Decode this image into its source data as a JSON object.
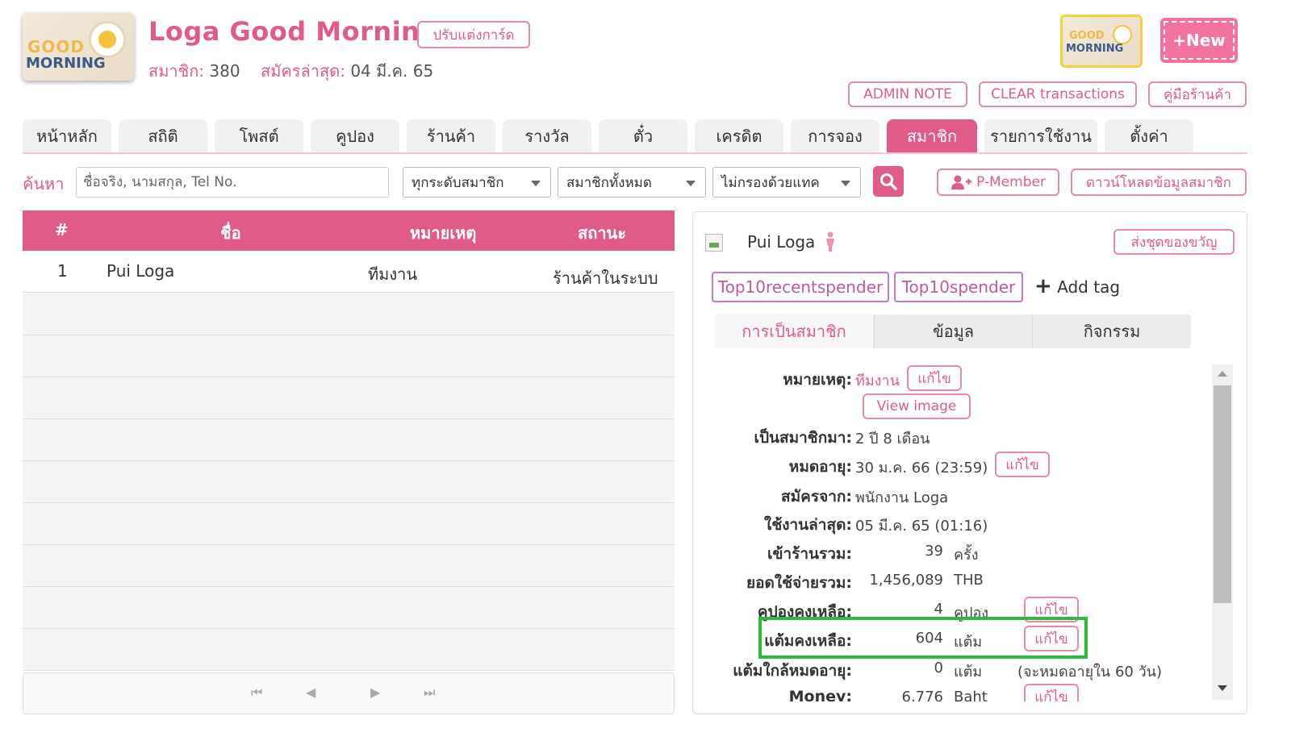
{
  "header": {
    "logo_text_top": "GOOD",
    "logo_text_bottom": "MORNING",
    "store_name": "Loga Good Morning",
    "customize_card_button": "ปรับแต่งการ์ด",
    "members_label": "สมาชิก:",
    "members_count": "380",
    "last_signup_label": "สมัครล่าสุด:",
    "last_signup_date": "04 มี.ค. 65",
    "new_button": "+New",
    "admin_note": "ADMIN NOTE",
    "clear_transactions": "CLEAR transactions",
    "store_manual": "คู่มือร้านค้า"
  },
  "tabs": [
    {
      "label": "หน้าหลัก",
      "active": false
    },
    {
      "label": "สถิติ",
      "active": false
    },
    {
      "label": "โพสต์",
      "active": false
    },
    {
      "label": "คูปอง",
      "active": false
    },
    {
      "label": "ร้านค้า",
      "active": false
    },
    {
      "label": "รางวัล",
      "active": false
    },
    {
      "label": "ตั๋ว",
      "active": false
    },
    {
      "label": "เครดิต",
      "active": false
    },
    {
      "label": "การจอง",
      "active": false
    },
    {
      "label": "สมาชิก",
      "active": true
    },
    {
      "label": "รายการใช้งาน",
      "active": false
    },
    {
      "label": "ตั้งค่า",
      "active": false
    }
  ],
  "search": {
    "label": "ค้นหา",
    "placeholder": "ชื่อจริง, นามสกุล, Tel No.",
    "level_filter": "ทุกระดับสมาชิก",
    "member_filter": "สมาชิกทั้งหมด",
    "tag_filter": "ไม่กรองด้วยแทค",
    "p_member_button": "P-Member",
    "download_button": "ดาวน์โหลดข้อมูลสมาชิก"
  },
  "table": {
    "headers": [
      "#",
      "ชื่อ",
      "หมายเหตุ",
      "สถานะ"
    ],
    "rows": [
      {
        "num": "1",
        "name": "Pui Loga",
        "note": "ทีมงาน",
        "status": "ร้านค้าในระบบ"
      }
    ]
  },
  "profile": {
    "name": "Pui Loga",
    "gift_button": "ส่งชุดของขวัญ",
    "tags": [
      "Top10recentspender",
      "Top10spender"
    ],
    "add_tag": "Add tag",
    "subtabs": [
      "การเป็นสมาชิก",
      "ข้อมูล",
      "กิจกรรม"
    ],
    "note_label": "หมายเหตุ:",
    "note_value": "ทีมงาน",
    "edit": "แก้ไข",
    "view_image": "View image",
    "member_since_label": "เป็นสมาชิกมา:",
    "member_since_value": "2 ปี 8 เดือน",
    "expiry_label": "หมดอายุ:",
    "expiry_value": "30 ม.ค. 66 (23:59)",
    "signup_from_label": "สมัครจาก:",
    "signup_from_value": "พนักงาน Loga",
    "last_used_label": "ใช้งานล่าสุด:",
    "last_used_value": "05 มี.ค. 65 (01:16)",
    "visits_label": "เข้าร้านรวม:",
    "visits_value": "39",
    "visits_unit": "ครั้ง",
    "spend_label": "ยอดใช้จ่ายรวม:",
    "spend_value": "1,456,089",
    "spend_unit": "THB",
    "coupons_label": "คูปองคงเหลือ:",
    "coupons_value": "4",
    "coupons_unit": "คูปอง",
    "points_label": "แต้มคงเหลือ:",
    "points_value": "604",
    "points_unit": "แต้ม",
    "expiring_label": "แต้มใกล้หมดอายุ:",
    "expiring_value": "0",
    "expiring_unit": "แต้ม",
    "expiring_note": "(จะหมดอายุใน 60 วัน)",
    "money_label": "Money:",
    "money_value": "6,776",
    "money_unit": "Baht"
  },
  "colors": {
    "brand_pink": "#e05a8a",
    "highlight_green": "#2fbb3a"
  }
}
